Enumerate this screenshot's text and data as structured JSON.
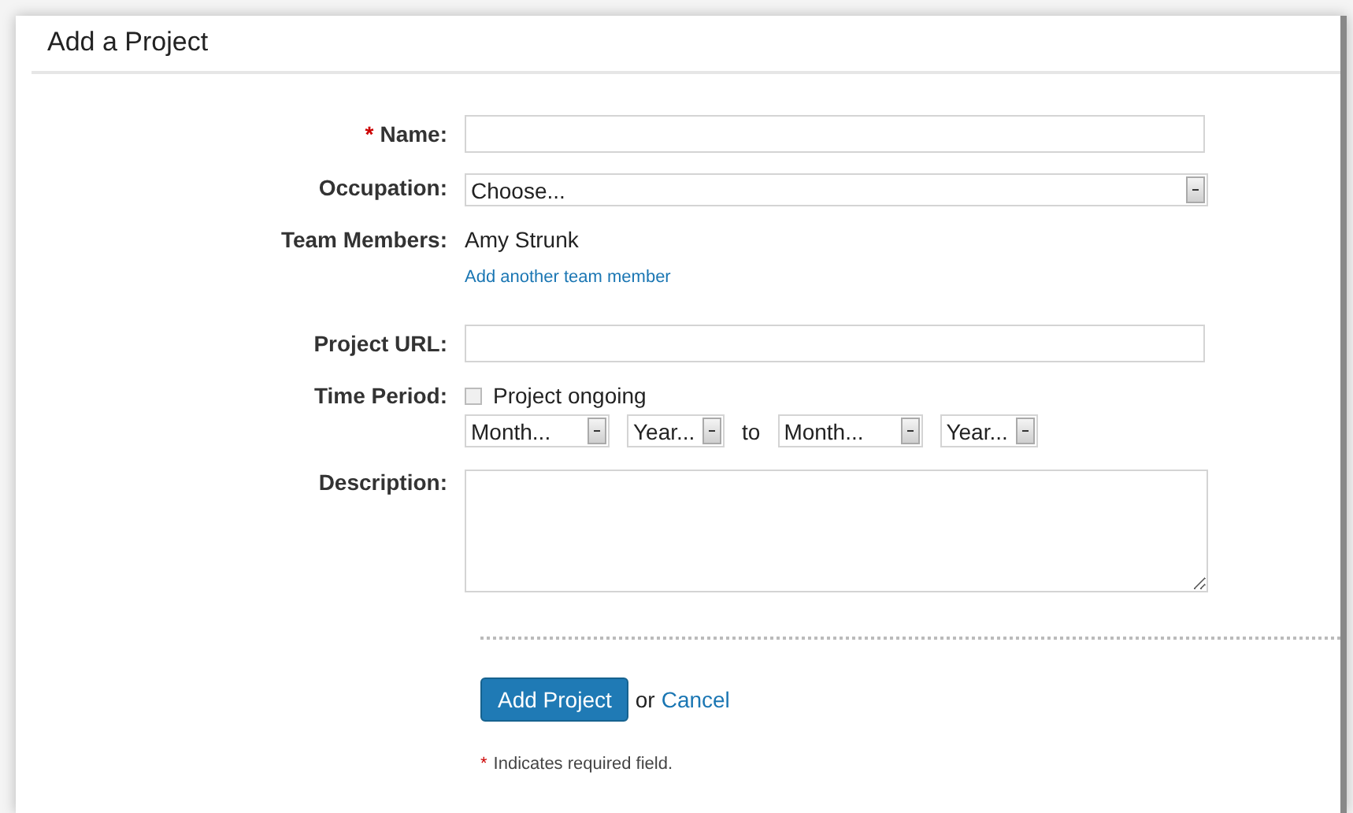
{
  "title": "Add a Project",
  "fields": [
    {
      "kind": "text",
      "label": "Name:",
      "required": true
    },
    {
      "kind": "select",
      "label": "Occupation:",
      "value": "Choose..."
    },
    {
      "kind": "static",
      "label": "Team Members:",
      "value": "Amy Strunk",
      "link": "Add another team member"
    },
    {
      "kind": "text",
      "label": "Project URL:",
      "required": false
    },
    {
      "kind": "period",
      "label": "Time Period:",
      "checkbox": {
        "label": "Project ongoing",
        "checked": false
      },
      "from": [
        "Month...",
        "Year..."
      ],
      "separator": "to",
      "until": [
        "Month...",
        "Year..."
      ]
    },
    {
      "kind": "textarea",
      "label": "Description:"
    }
  ],
  "submit": "Add Project",
  "or": "or",
  "cancel": "Cancel",
  "note": {
    "mark": "*",
    "text": "Indicates required field."
  }
}
